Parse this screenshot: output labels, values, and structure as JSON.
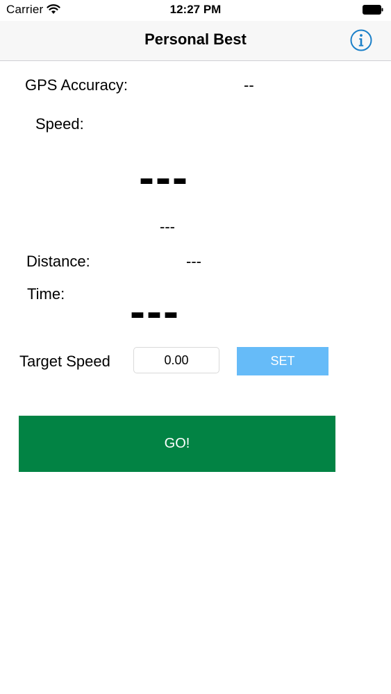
{
  "status_bar": {
    "carrier": "Carrier",
    "time": "12:27 PM"
  },
  "nav": {
    "title": "Personal Best",
    "info_icon": "info-circle-icon"
  },
  "gps": {
    "label": "GPS Accuracy:",
    "value": "--"
  },
  "speed": {
    "label": "Speed:",
    "value": "---",
    "secondary_value": "---"
  },
  "distance": {
    "label": "Distance:",
    "value": "---"
  },
  "time": {
    "label": "Time:",
    "value": "---"
  },
  "target": {
    "label": "Target Speed",
    "value": "0.00",
    "set_label": "SET"
  },
  "go": {
    "label": "GO!"
  },
  "colors": {
    "accent": "#1a7fc8",
    "set_button": "#66bbf8",
    "go_button": "#028344",
    "navbar": "#f7f7f7"
  }
}
